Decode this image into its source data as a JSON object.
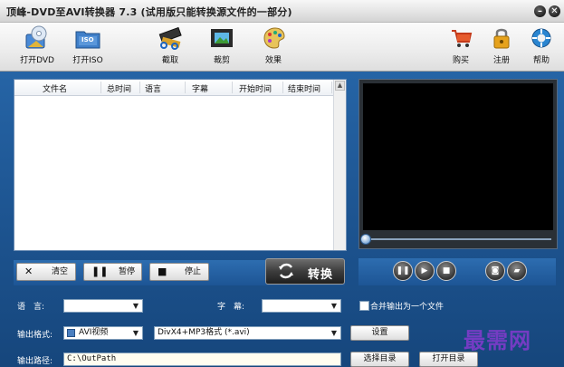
{
  "window": {
    "title": "顶峰-DVD至AVI转换器 7.3 (试用版只能转换源文件的一部分)",
    "minimize_glyph": "–",
    "close_glyph": "✕"
  },
  "toolbar": {
    "open_dvd": "打开DVD",
    "open_iso": "打开ISO",
    "iso_badge": "ISO",
    "capture": "截取",
    "crop": "裁剪",
    "effects": "效果",
    "buy": "购买",
    "register": "注册",
    "help": "帮助"
  },
  "file_list": {
    "columns": [
      "文件名",
      "总时间",
      "语言",
      "字幕",
      "开始时间",
      "结束时间"
    ],
    "rows": []
  },
  "controls": {
    "clear": "清空",
    "pause": "暂停",
    "stop": "停止",
    "convert": "转换"
  },
  "player": {
    "buttons": [
      "pause",
      "play",
      "stop",
      "snapshot",
      "open-folder"
    ]
  },
  "settings": {
    "language_label": "语　言:",
    "language_value": "",
    "subtitle_label": "字　幕:",
    "subtitle_value": "",
    "merge_label": "合并输出为一个文件",
    "output_format_label": "输出格式:",
    "output_format_value": "AVI视频",
    "codec_value": "DivX4+MP3格式 (*.avi)",
    "setup_button": "设置",
    "output_path_label": "输出路径:",
    "output_path_value": "C:\\OutPath",
    "choose_dir_button": "选择目录",
    "open_dir_button": "打开目录"
  },
  "watermark": "最需网",
  "colors": {
    "frame_blue": "#1e5693",
    "video_black": "#000000",
    "watermark_purple": "#7a3cc7"
  }
}
